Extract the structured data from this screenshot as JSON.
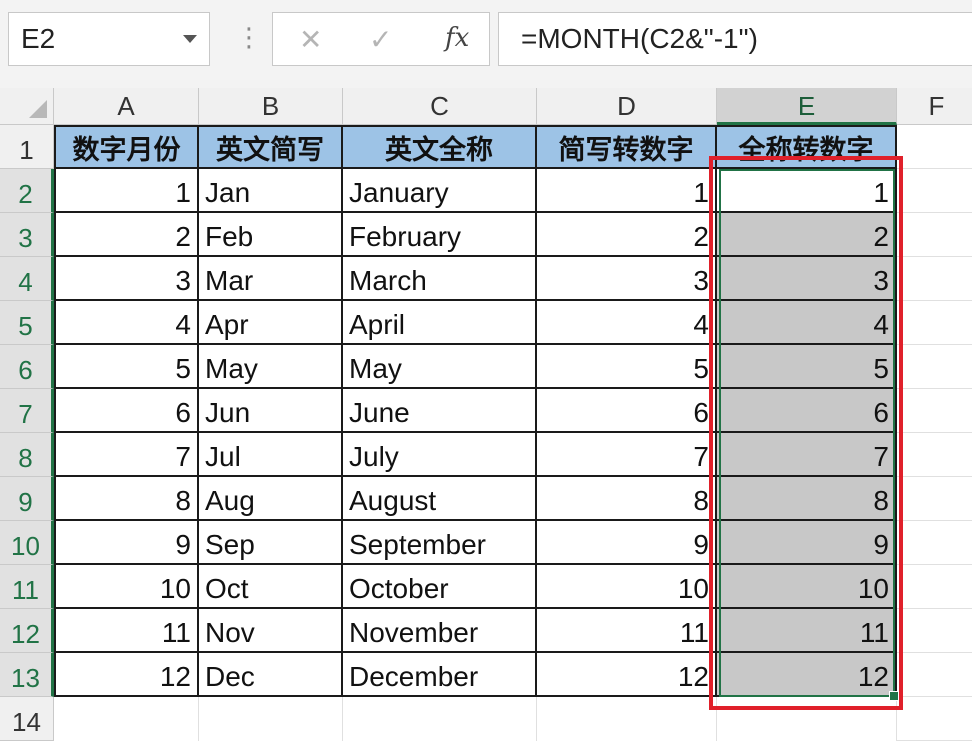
{
  "name_box": "E2",
  "formula": "=MONTH(C2&\"-1\")",
  "toolbar": {
    "separator": "⋮",
    "cancel": "✕",
    "enter": "✓",
    "fx": "fx"
  },
  "columns": [
    "A",
    "B",
    "C",
    "D",
    "E",
    "F"
  ],
  "rows": [
    "1",
    "2",
    "3",
    "4",
    "5",
    "6",
    "7",
    "8",
    "9",
    "10",
    "11",
    "12",
    "13",
    "14"
  ],
  "headers": [
    "数字月份",
    "英文简写",
    "英文全称",
    "简写转数字",
    "全称转数字"
  ],
  "table": [
    [
      "1",
      "Jan",
      "January",
      "1",
      "1"
    ],
    [
      "2",
      "Feb",
      "February",
      "2",
      "2"
    ],
    [
      "3",
      "Mar",
      "March",
      "3",
      "3"
    ],
    [
      "4",
      "Apr",
      "April",
      "4",
      "4"
    ],
    [
      "5",
      "May",
      "May",
      "5",
      "5"
    ],
    [
      "6",
      "Jun",
      "June",
      "6",
      "6"
    ],
    [
      "7",
      "Jul",
      "July",
      "7",
      "7"
    ],
    [
      "8",
      "Aug",
      "August",
      "8",
      "8"
    ],
    [
      "9",
      "Sep",
      "September",
      "9",
      "9"
    ],
    [
      "10",
      "Oct",
      "October",
      "10",
      "10"
    ],
    [
      "11",
      "Nov",
      "November",
      "11",
      "11"
    ],
    [
      "12",
      "Dec",
      "December",
      "12",
      "12"
    ]
  ],
  "colors": {
    "header_fill": "#9dc3e6",
    "selection_fill": "#c8c8c8",
    "selection_border": "#217346",
    "annotation": "#e0202a"
  }
}
